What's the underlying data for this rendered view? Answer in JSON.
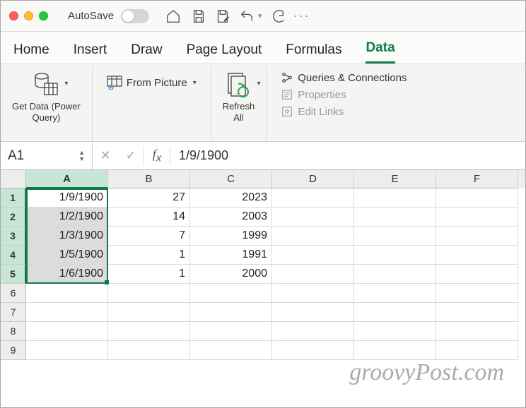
{
  "autosave_label": "AutoSave",
  "tabs": [
    "Home",
    "Insert",
    "Draw",
    "Page Layout",
    "Formulas",
    "Data"
  ],
  "active_tab": 5,
  "ribbon": {
    "get_data": "Get Data (Power\nQuery)",
    "from_picture": "From Picture",
    "refresh_all": "Refresh\nAll",
    "queries": "Queries & Connections",
    "properties": "Properties",
    "edit_links": "Edit Links"
  },
  "name_box": "A1",
  "formula": "1/9/1900",
  "columns": [
    "A",
    "B",
    "C",
    "D",
    "E",
    "F"
  ],
  "selected_col": 0,
  "rows": [
    {
      "n": 1,
      "cells": [
        "1/9/1900",
        "27",
        "2023",
        "",
        "",
        ""
      ]
    },
    {
      "n": 2,
      "cells": [
        "1/2/1900",
        "14",
        "2003",
        "",
        "",
        ""
      ]
    },
    {
      "n": 3,
      "cells": [
        "1/3/1900",
        "7",
        "1999",
        "",
        "",
        ""
      ]
    },
    {
      "n": 4,
      "cells": [
        "1/5/1900",
        "1",
        "1991",
        "",
        "",
        ""
      ]
    },
    {
      "n": 5,
      "cells": [
        "1/6/1900",
        "1",
        "2000",
        "",
        "",
        ""
      ]
    },
    {
      "n": 6,
      "cells": [
        "",
        "",
        "",
        "",
        "",
        ""
      ]
    },
    {
      "n": 7,
      "cells": [
        "",
        "",
        "",
        "",
        "",
        ""
      ]
    },
    {
      "n": 8,
      "cells": [
        "",
        "",
        "",
        "",
        "",
        ""
      ]
    },
    {
      "n": 9,
      "cells": [
        "",
        "",
        "",
        "",
        "",
        ""
      ]
    }
  ],
  "watermark": "groovyPost.com"
}
